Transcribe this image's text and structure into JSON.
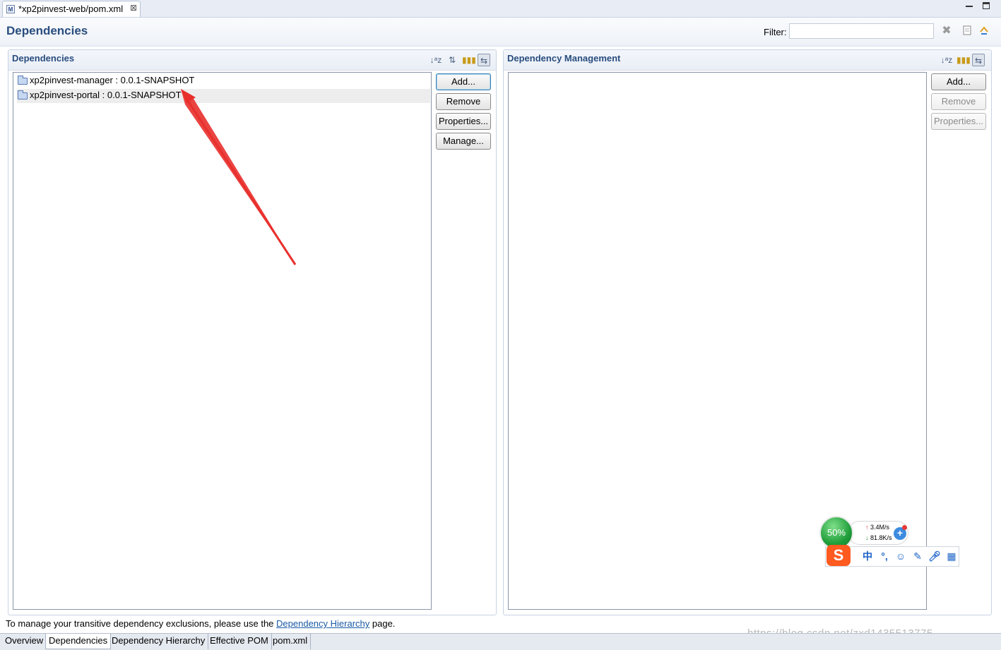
{
  "editor_tab": {
    "title": "*xp2pinvest-web/pom.xml",
    "icon_text": "M",
    "close_glyph": "⊠"
  },
  "header": {
    "title": "Dependencies",
    "filter_label": "Filter:",
    "filter_value": ""
  },
  "left": {
    "title": "Dependencies",
    "items": [
      {
        "label": "xp2pinvest-manager : 0.0.1-SNAPSHOT"
      },
      {
        "label": "xp2pinvest-portal : 0.0.1-SNAPSHOT"
      }
    ],
    "buttons": {
      "add": "Add...",
      "remove": "Remove",
      "properties": "Properties...",
      "manage": "Manage..."
    }
  },
  "right": {
    "title": "Dependency Management",
    "buttons": {
      "add": "Add...",
      "remove": "Remove",
      "properties": "Properties..."
    }
  },
  "footer": {
    "before": "To manage your transitive dependency exclusions, please use the",
    "link": "Dependency Hierarchy",
    "after": "page."
  },
  "bottom_tabs": [
    "Overview",
    "Dependencies",
    "Dependency Hierarchy",
    "Effective POM",
    "pom.xml"
  ],
  "active_bottom_tab": "Dependencies",
  "ime": {
    "cpu_percent": "50%",
    "upload": "3.4M/s",
    "download": "81.8K/s",
    "logo": "S",
    "chinese_mode": "中",
    "punct": "°,"
  },
  "watermark": "https://blog.csdn.net/zxd1435513775",
  "colors": {
    "title_blue": "#294d7e",
    "arrow_red": "#e8302c",
    "link_blue": "#1a5aa6"
  }
}
